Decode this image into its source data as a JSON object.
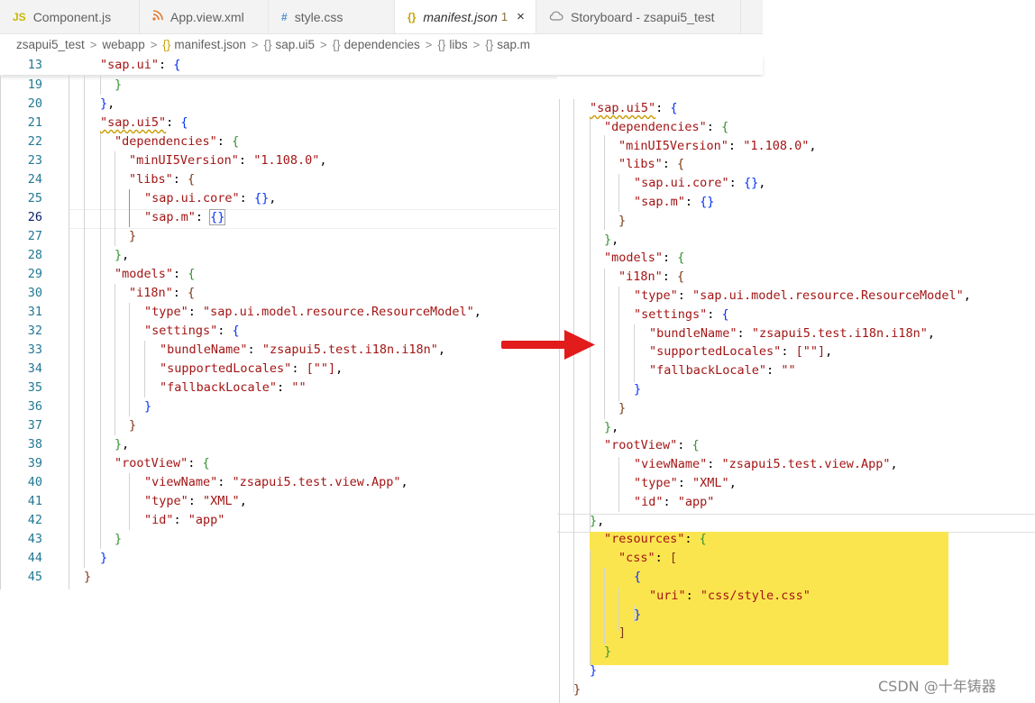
{
  "tabs": [
    {
      "icon": "JS",
      "label": "Component.js",
      "icon_color": "#c8b900"
    },
    {
      "icon": "rss",
      "label": "App.view.xml",
      "icon_color": "#e37933"
    },
    {
      "icon": "#",
      "label": "style.css",
      "icon_color": "#4d8fce"
    },
    {
      "icon": "{}",
      "label": "manifest.json",
      "modified": "1",
      "close": "×",
      "icon_color": "#c8a200"
    },
    {
      "icon": "cloud",
      "label": "Storyboard - zsapui5_test",
      "icon_color": "#888888"
    }
  ],
  "breadcrumb": {
    "root": "zsapui5_test",
    "folder": "webapp",
    "file": "manifest.json",
    "s1": "sap.ui5",
    "s2": "dependencies",
    "s3": "libs",
    "s4": "sap.m",
    "brace": "{}",
    "sep": ">"
  },
  "left_numbers": [
    "13",
    "19",
    "20",
    "21",
    "22",
    "23",
    "24",
    "25",
    "26",
    "27",
    "28",
    "29",
    "30",
    "31",
    "32",
    "33",
    "34",
    "35",
    "36",
    "37",
    "38",
    "39",
    "40",
    "41",
    "42",
    "43",
    "44",
    "45"
  ],
  "left_code": {
    "l13": [
      "\"sap.ui\"",
      ": ",
      "{"
    ],
    "l19": "}",
    "l20": [
      "}",
      ","
    ],
    "l21": [
      "\"sap.ui5\"",
      ": ",
      "{"
    ],
    "l22": [
      "\"dependencies\"",
      ": ",
      "{"
    ],
    "l23": [
      "\"minUI5Version\"",
      ": ",
      "\"1.108.0\"",
      ","
    ],
    "l24": [
      "\"libs\"",
      ": ",
      "{"
    ],
    "l25": [
      "\"sap.ui.core\"",
      ": ",
      "{}",
      ","
    ],
    "l26": [
      "\"sap.m\"",
      ": ",
      "{}"
    ],
    "l27": "}",
    "l28": [
      "}",
      ","
    ],
    "l29": [
      "\"models\"",
      ": ",
      "{"
    ],
    "l30": [
      "\"i18n\"",
      ": ",
      "{"
    ],
    "l31": [
      "\"type\"",
      ": ",
      "\"sap.ui.model.resource.ResourceModel\"",
      ","
    ],
    "l32": [
      "\"settings\"",
      ": ",
      "{"
    ],
    "l33": [
      "\"bundleName\"",
      ": ",
      "\"zsapui5.test.i18n.i18n\"",
      ","
    ],
    "l34": [
      "\"supportedLocales\"",
      ": ",
      "[\"\"]",
      ","
    ],
    "l35": [
      "\"fallbackLocale\"",
      ": ",
      "\"\""
    ],
    "l36": "}",
    "l37": "}",
    "l38": [
      "}",
      ","
    ],
    "l39": [
      "\"rootView\"",
      ": ",
      "{"
    ],
    "l40": [
      "\"viewName\"",
      ": ",
      "\"zsapui5.test.view.App\"",
      ","
    ],
    "l41": [
      "\"type\"",
      ": ",
      "\"XML\"",
      ","
    ],
    "l42": [
      "\"id\"",
      ": ",
      "\"app\""
    ],
    "l43": "}",
    "l44": "}",
    "l45": "}"
  },
  "right_code": {
    "r1": [
      "\"sap.ui5\"",
      ": ",
      "{"
    ],
    "r2": [
      "\"dependencies\"",
      ": ",
      "{"
    ],
    "r3": [
      "\"minUI5Version\"",
      ": ",
      "\"1.108.0\"",
      ","
    ],
    "r4": [
      "\"libs\"",
      ": ",
      "{"
    ],
    "r5": [
      "\"sap.ui.core\"",
      ": ",
      "{}",
      ","
    ],
    "r6": [
      "\"sap.m\"",
      ": ",
      "{}"
    ],
    "r7": "}",
    "r8": [
      "}",
      ","
    ],
    "r9": [
      "\"models\"",
      ": ",
      "{"
    ],
    "r10": [
      "\"i18n\"",
      ": ",
      "{"
    ],
    "r11": [
      "\"type\"",
      ": ",
      "\"sap.ui.model.resource.ResourceModel\"",
      ","
    ],
    "r12": [
      "\"settings\"",
      ": ",
      "{"
    ],
    "r13": [
      "\"bundleName\"",
      ": ",
      "\"zsapui5.test.i18n.i18n\"",
      ","
    ],
    "r14": [
      "\"supportedLocales\"",
      ": ",
      "[\"\"]",
      ","
    ],
    "r15": [
      "\"fallbackLocale\"",
      ": ",
      "\"\""
    ],
    "r16": "}",
    "r17": "}",
    "r18": [
      "}",
      ","
    ],
    "r19": [
      "\"rootView\"",
      ": ",
      "{"
    ],
    "r20": [
      "\"viewName\"",
      ": ",
      "\"zsapui5.test.view.App\"",
      ","
    ],
    "r21": [
      "\"type\"",
      ": ",
      "\"XML\"",
      ","
    ],
    "r22": [
      "\"id\"",
      ": ",
      "\"app\""
    ],
    "r23": [
      "}",
      ","
    ],
    "r24": [
      "\"resources\"",
      ": ",
      "{"
    ],
    "r25": [
      "\"css\"",
      ": ",
      "["
    ],
    "r26": "{",
    "r27": [
      "\"uri\"",
      ": ",
      "\"css/style.css\""
    ],
    "r28": "}",
    "r29": "]",
    "r30": "}",
    "r31": "}",
    "r32": "}"
  },
  "colors": {
    "highlight": "#fbe54f",
    "arrow": "#e21b1b",
    "key": "#a31515",
    "line_number": "#237893"
  },
  "watermark": "CSDN @十年铸器"
}
